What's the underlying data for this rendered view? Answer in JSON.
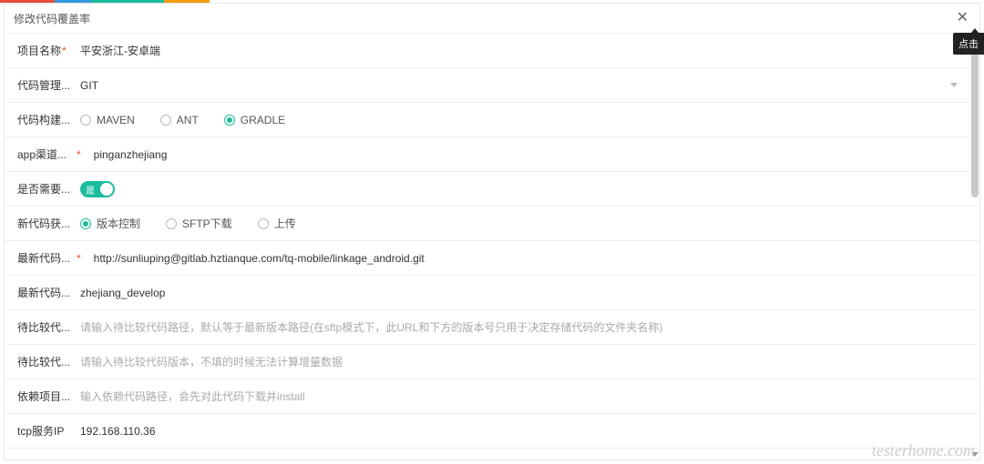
{
  "modal": {
    "title": "修改代码覆盖率",
    "tooltip": "点击"
  },
  "fields": {
    "project_name": {
      "label": "项目名称",
      "required": true,
      "value": "平安浙江-安卓端"
    },
    "repo_type": {
      "label": "代码管理...",
      "required": false,
      "value": "GIT"
    },
    "build_tool": {
      "label": "代码构建...",
      "required": false,
      "options": [
        "MAVEN",
        "ANT",
        "GRADLE"
      ],
      "selected": "GRADLE"
    },
    "app_channel": {
      "label": "app渠道...",
      "required": true,
      "value": "pinganzhejiang"
    },
    "need": {
      "label": "是否需要...",
      "required": false,
      "on_text": "是",
      "on": true
    },
    "new_code": {
      "label": "新代码获...",
      "required": false,
      "options": [
        "版本控制",
        "SFTP下载",
        "上传"
      ],
      "selected": "版本控制"
    },
    "latest_url": {
      "label": "最新代码...",
      "required": true,
      "value": "http://sunliuping@gitlab.hztianque.com/tq-mobile/linkage_android.git"
    },
    "latest_branch": {
      "label": "最新代码...",
      "required": false,
      "value": "zhejiang_develop"
    },
    "compare_path": {
      "label": "待比较代...",
      "required": false,
      "value": "",
      "placeholder": "请输入待比较代码路径，默认等于最新版本路径(在sftp模式下，此URL和下方的版本号只用于决定存储代码的文件夹名称)"
    },
    "compare_ver": {
      "label": "待比较代...",
      "required": false,
      "value": "",
      "placeholder": "请输入待比较代码版本，不填的时候无法计算增量数据"
    },
    "deps": {
      "label": "依赖项目...",
      "required": false,
      "value": "",
      "placeholder": "输入依赖代码路径，会先对此代码下载并install"
    },
    "tcp_ip": {
      "label": "tcp服务IP",
      "required": false,
      "value": "192.168.110.36"
    }
  },
  "watermark": "testerhome.com"
}
